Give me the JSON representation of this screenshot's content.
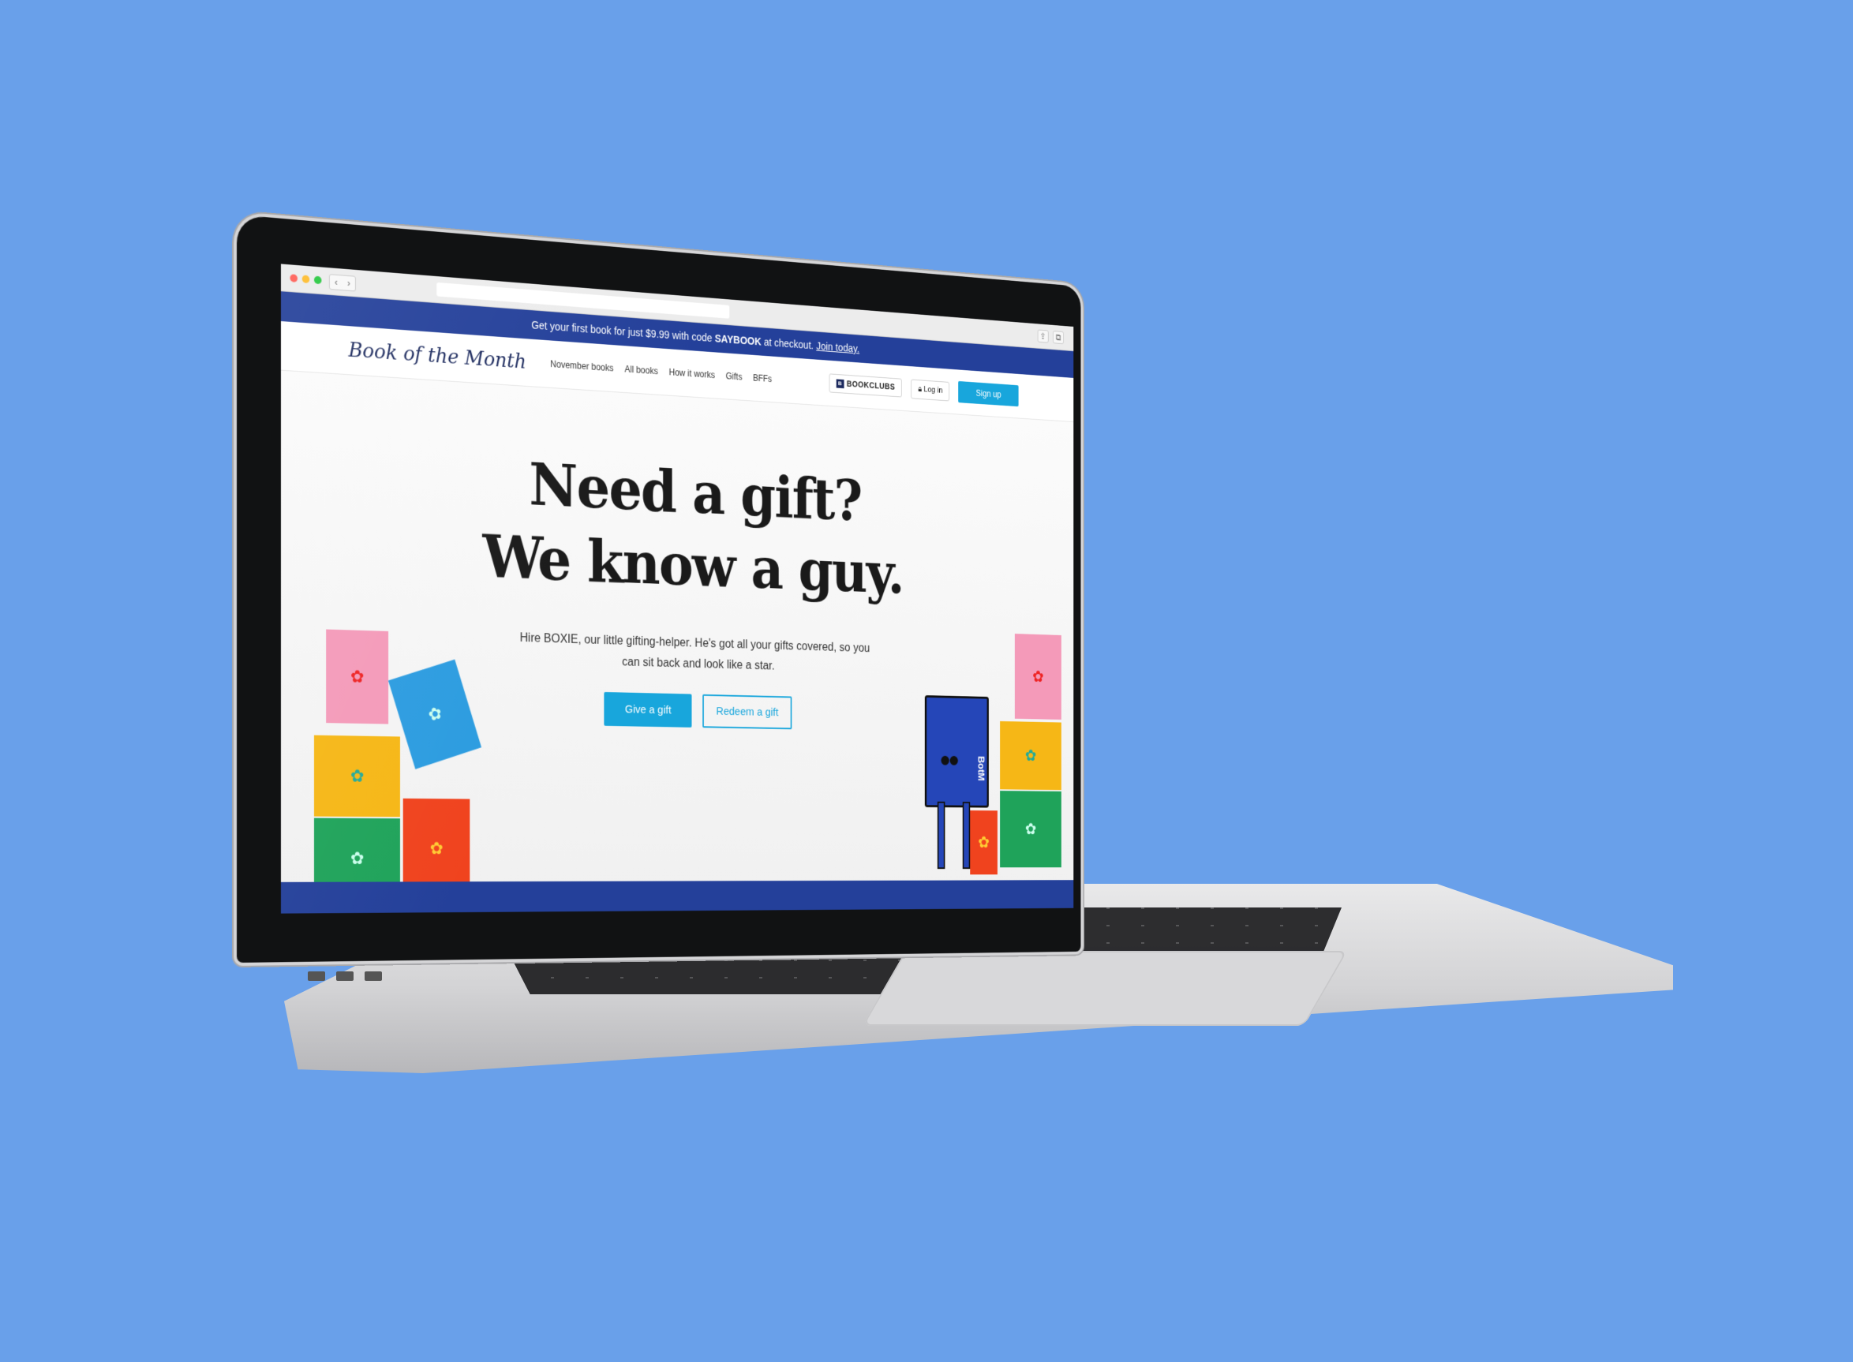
{
  "promo": {
    "text_before": "Get your first book for just $9.99 with code",
    "code": "SAYBOOK",
    "text_after": "at checkout.",
    "link": "Join today."
  },
  "nav": {
    "logo": "Book of the Month",
    "links": [
      "November books",
      "All books",
      "How it works",
      "Gifts",
      "BFFs"
    ],
    "bookclubs": "BOOKCLUBS",
    "login": "Log in",
    "signup": "Sign up"
  },
  "hero": {
    "title_line1": "Need a gift?",
    "title_line2": "We know a guy.",
    "subtitle_line1": "Hire BOXIE, our little gifting-helper. He's got all your gifts covered, so you",
    "subtitle_line2": "can sit back and look like a star.",
    "primary_button": "Give a gift",
    "secondary_button": "Redeem a gift",
    "mascot_label": "BotM"
  },
  "colors": {
    "background": "#69a0ea",
    "promo_bar": "#24409a",
    "accent": "#18a6dc"
  }
}
